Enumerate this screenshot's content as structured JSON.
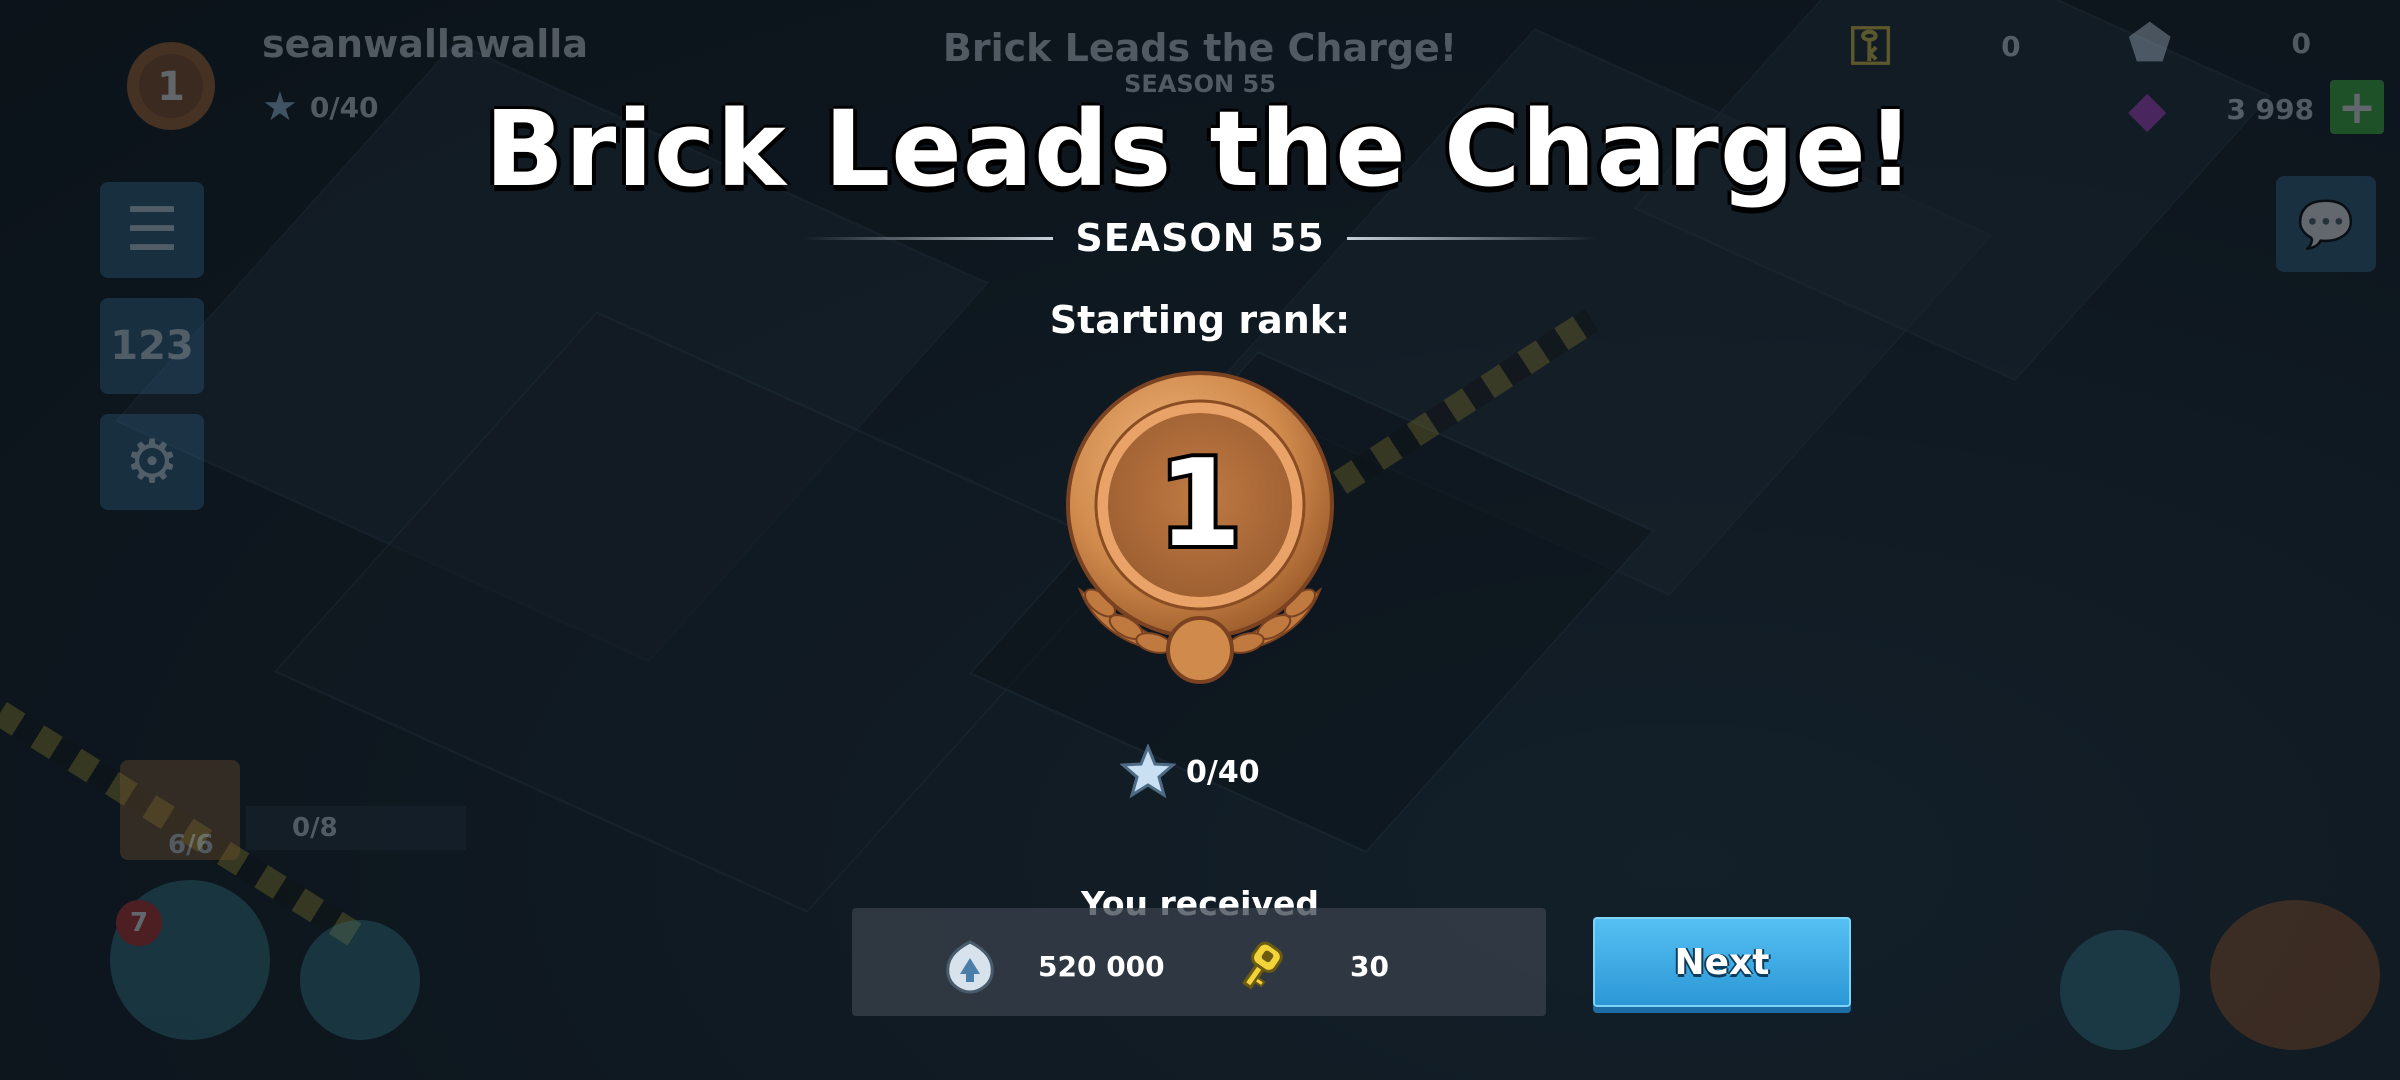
{
  "overlay": {
    "title": "Brick Leads the Charge!",
    "season": "SEASON 55",
    "starting_rank_label": "Starting rank:",
    "rank_number": "1",
    "stars": "0/40",
    "received_label": "You received",
    "rewards": [
      {
        "icon": "intel-icon",
        "value": "520 000"
      },
      {
        "icon": "key-icon",
        "value": "30"
      }
    ],
    "next_label": "Next"
  },
  "hud": {
    "player_name": "seanwallawalla",
    "player_rank": "1",
    "player_stars": "0/40",
    "bg_title": "Brick Leads the Charge!",
    "bg_season": "SEASON 55",
    "keys": "0",
    "intel": "0",
    "diamonds": "3 998",
    "chest_count": "6/6",
    "task_progress": "0/8",
    "badge_count": "7"
  },
  "colors": {
    "bronze": "#d08a4c",
    "button": "#3aa8e3",
    "diamond": "#b03cc8",
    "plus": "#3fbf3a"
  }
}
